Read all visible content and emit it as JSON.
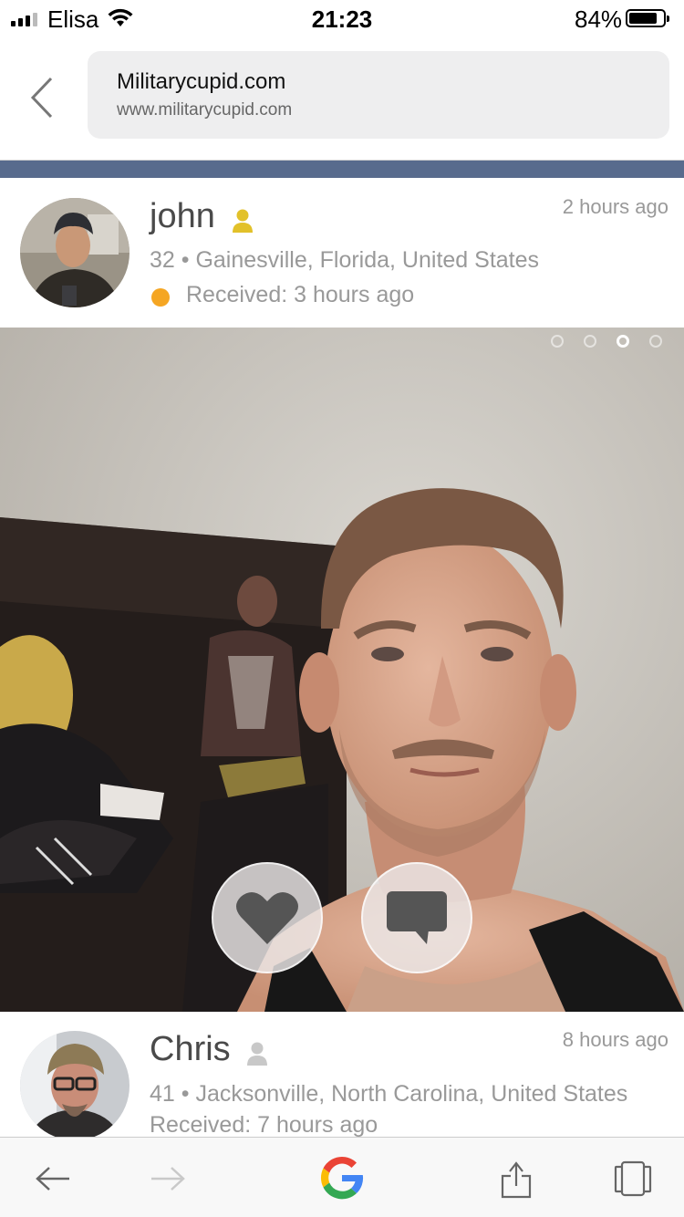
{
  "status_bar": {
    "carrier": "Elisa",
    "time": "21:23",
    "battery_percent": "84%",
    "battery_level": 0.84,
    "signal_bars": 3
  },
  "browser": {
    "site_title": "Militarycupid.com",
    "site_url": "www.militarycupid.com"
  },
  "colors": {
    "accent_band": "#586b8d",
    "online_dot": "#f5a623",
    "verified_icon": "#e2c12a",
    "unverified_icon": "#c8c8c8"
  },
  "profiles": [
    {
      "name": "john",
      "time_ago": "2 hours ago",
      "location": "32 • Gainesville, Florida, United States",
      "received": "Received: 3 hours ago",
      "online": true,
      "icon": "user-icon-yellow"
    },
    {
      "name": "Chris",
      "time_ago": "8 hours ago",
      "location": "41 • Jacksonville, North Carolina, United States",
      "received": "Received: 7 hours ago",
      "online": false,
      "icon": "user-icon-grey"
    }
  ],
  "photo": {
    "slide_count": 4,
    "active_slide": 3,
    "like_icon": "heart-icon",
    "message_icon": "chat-bubble-icon"
  },
  "toolbar": {
    "back_icon": "arrow-left-icon",
    "forward_icon": "arrow-right-icon",
    "google_icon": "google-logo-icon",
    "share_icon": "share-icon",
    "tabs_icon": "tabs-icon"
  }
}
